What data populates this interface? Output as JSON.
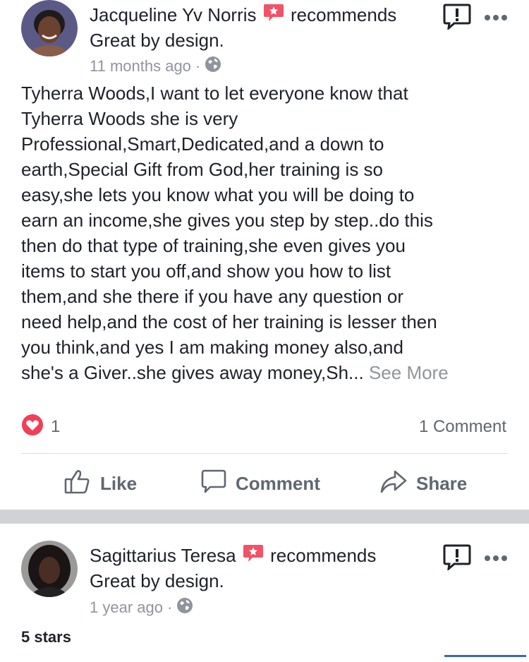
{
  "post1": {
    "author": "Jacqueline Yv Norris",
    "recommends": "recommends",
    "page_name": "Great by design.",
    "time": "11 months ago",
    "dot": "·",
    "body": "Tyherra Woods,I want to let everyone know that\nTyherra Woods she is very\nProfessional,Smart,Dedicated,and a down to\nearth,Special Gift from God,her training is so\neasy,she lets you know what you will be doing to\nearn an income,she gives you step by step..do this\nthen do that type of training,she even gives you\nitems to start you off,and show you how to list\nthem,and she there if you have any question or\nneed help,and the cost of her training is lesser then\nyou think,and yes I am making money also,and\nshe's a Giver..she gives away money,Sh...",
    "see_more": "See More",
    "reaction_count": "1",
    "comment_count": "1 Comment"
  },
  "actions": {
    "like": "Like",
    "comment": "Comment",
    "share": "Share"
  },
  "post2": {
    "author": "Sagittarius Teresa",
    "recommends": "recommends",
    "page_name": "Great by design.",
    "time": "1 year ago",
    "dot": "·",
    "body": "5 stars"
  },
  "icons": [
    "recommend-badge-icon",
    "globe-icon",
    "report-icon",
    "more-icon",
    "heart-reaction-icon",
    "like-icon",
    "comment-icon",
    "share-icon"
  ],
  "colors": {
    "badge_red": "#f25268",
    "heart_red": "#f33e58",
    "meta_gray": "#90949c",
    "action_gray": "#606770",
    "accent_blue": "#4267b2"
  }
}
